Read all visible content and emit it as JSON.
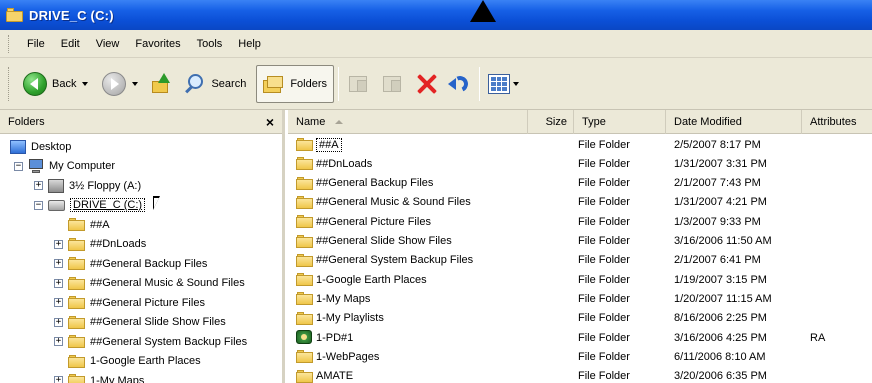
{
  "window": {
    "title": "DRIVE_C (C:)"
  },
  "menu": [
    "File",
    "Edit",
    "View",
    "Favorites",
    "Tools",
    "Help"
  ],
  "toolbar": {
    "back": "Back",
    "search": "Search",
    "folders": "Folders"
  },
  "folders_pane": {
    "title": "Folders",
    "close": "×",
    "tree": [
      {
        "label": "Desktop",
        "icon": "desktop-icon",
        "indent": 0,
        "expander": ""
      },
      {
        "label": "My Computer",
        "icon": "computer-icon",
        "indent": 1,
        "expander": "−"
      },
      {
        "label": "3½ Floppy (A:)",
        "icon": "floppy-icon",
        "indent": 2,
        "expander": "+"
      },
      {
        "label": "DRIVE_C (C:)",
        "icon": "drive-icon",
        "indent": 2,
        "expander": "−",
        "selected": true
      },
      {
        "label": "##A",
        "icon": "folder-icon",
        "indent": 3,
        "expander": ""
      },
      {
        "label": "##DnLoads",
        "icon": "folder-icon",
        "indent": 3,
        "expander": "+"
      },
      {
        "label": "##General Backup Files",
        "icon": "folder-icon",
        "indent": 3,
        "expander": "+"
      },
      {
        "label": "##General Music & Sound Files",
        "icon": "folder-icon",
        "indent": 3,
        "expander": "+"
      },
      {
        "label": "##General Picture Files",
        "icon": "folder-icon",
        "indent": 3,
        "expander": "+"
      },
      {
        "label": "##General Slide Show Files",
        "icon": "folder-icon",
        "indent": 3,
        "expander": "+"
      },
      {
        "label": "##General System Backup Files",
        "icon": "folder-icon",
        "indent": 3,
        "expander": "+"
      },
      {
        "label": "1-Google Earth Places",
        "icon": "folder-icon",
        "indent": 3,
        "expander": ""
      },
      {
        "label": "1-My Maps",
        "icon": "folder-icon",
        "indent": 3,
        "expander": "+"
      }
    ]
  },
  "file_list": {
    "columns": {
      "name": "Name",
      "size": "Size",
      "type": "Type",
      "date": "Date Modified",
      "attributes": "Attributes"
    },
    "rows": [
      {
        "name": "##A",
        "type": "File Folder",
        "date": "2/5/2007 8:17 PM",
        "attr": "",
        "focused": true
      },
      {
        "name": "##DnLoads",
        "type": "File Folder",
        "date": "1/31/2007 3:31 PM",
        "attr": ""
      },
      {
        "name": "##General Backup Files",
        "type": "File Folder",
        "date": "2/1/2007 7:43 PM",
        "attr": ""
      },
      {
        "name": "##General Music & Sound Files",
        "type": "File Folder",
        "date": "1/31/2007 4:21 PM",
        "attr": ""
      },
      {
        "name": "##General Picture Files",
        "type": "File Folder",
        "date": "1/3/2007 9:33 PM",
        "attr": ""
      },
      {
        "name": "##General Slide Show Files",
        "type": "File Folder",
        "date": "3/16/2006 11:50 AM",
        "attr": ""
      },
      {
        "name": "##General System Backup Files",
        "type": "File Folder",
        "date": "2/1/2007 6:41 PM",
        "attr": ""
      },
      {
        "name": "1-Google Earth Places",
        "type": "File Folder",
        "date": "1/19/2007 3:15 PM",
        "attr": ""
      },
      {
        "name": "1-My Maps",
        "type": "File Folder",
        "date": "1/20/2007 11:15 AM",
        "attr": ""
      },
      {
        "name": "1-My Playlists",
        "type": "File Folder",
        "date": "8/16/2006 2:25 PM",
        "attr": ""
      },
      {
        "name": "1-PD#1",
        "type": "File Folder",
        "date": "3/16/2006 4:25 PM",
        "attr": "RA",
        "special": true
      },
      {
        "name": "1-WebPages",
        "type": "File Folder",
        "date": "6/11/2006 8:10 AM",
        "attr": ""
      },
      {
        "name": "AMATE",
        "type": "File Folder",
        "date": "3/20/2006 6:35 PM",
        "attr": ""
      }
    ]
  }
}
